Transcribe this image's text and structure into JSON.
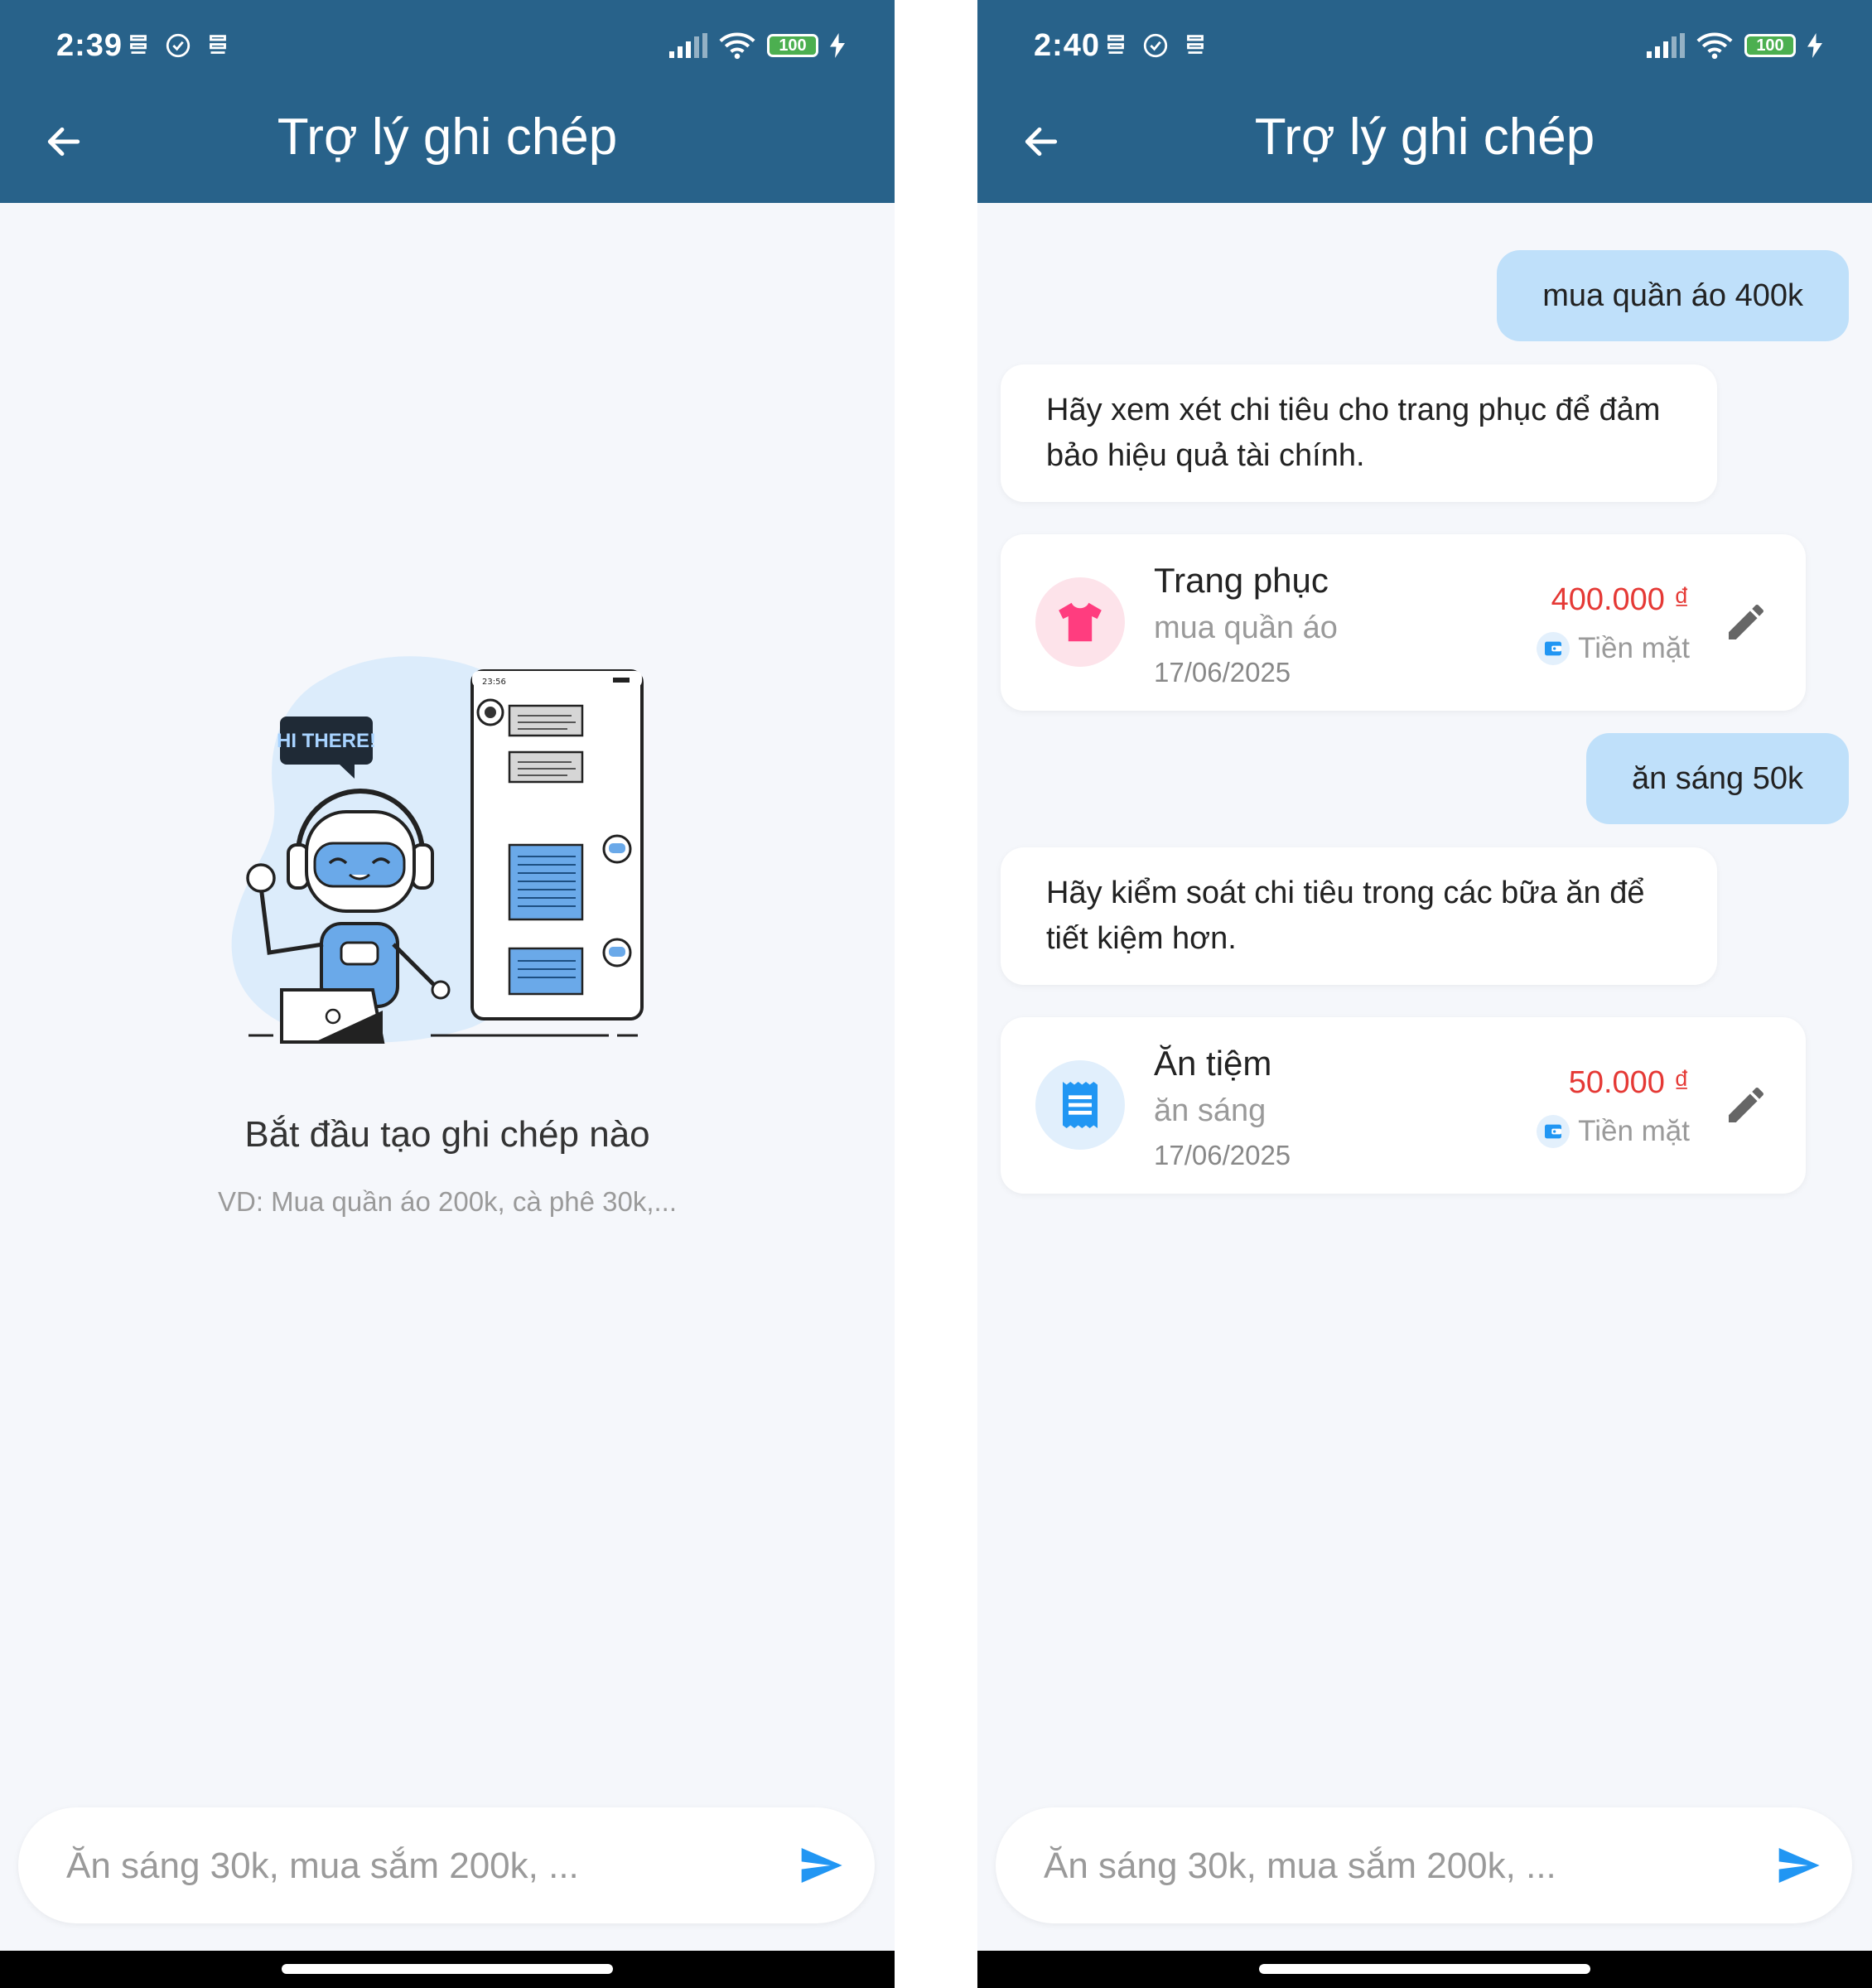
{
  "colors": {
    "header": "#28628a",
    "background": "#f5f7fb",
    "user_bubble": "#bfe0fa",
    "amount": "#e53935",
    "send": "#2196f3"
  },
  "left": {
    "status": {
      "time": "2:39",
      "battery": "100"
    },
    "app_bar": {
      "title": "Trợ lý ghi chép"
    },
    "illustration": {
      "bubble_text": "HI THERE!",
      "phone_clock": "23:56"
    },
    "empty_state": {
      "title": "Bắt đầu tạo ghi chép nào",
      "hint": "VD: Mua quần áo 200k, cà phê 30k,..."
    },
    "input": {
      "placeholder": "Ăn sáng 30k, mua sắm 200k, ..."
    }
  },
  "right": {
    "status": {
      "time": "2:40",
      "battery": "100"
    },
    "app_bar": {
      "title": "Trợ lý ghi chép"
    },
    "messages": [
      {
        "role": "user",
        "text": "mua quần áo 400k"
      },
      {
        "role": "bot",
        "text": "Hãy xem xét chi tiêu cho trang phục để đảm bảo hiệu quả tài chính."
      },
      {
        "role": "transaction",
        "icon": "tshirt-icon",
        "category": "Trang phục",
        "note": "mua quần áo",
        "date": "17/06/2025",
        "amount": "400.000 ₫",
        "wallet": "Tiền mặt"
      },
      {
        "role": "user",
        "text": "ăn sáng 50k"
      },
      {
        "role": "bot",
        "text": "Hãy kiểm soát chi tiêu trong các bữa ăn để tiết kiệm hơn."
      },
      {
        "role": "transaction",
        "icon": "receipt-icon",
        "category": "Ăn tiệm",
        "note": "ăn sáng",
        "date": "17/06/2025",
        "amount": "50.000 ₫",
        "wallet": "Tiền mặt"
      }
    ],
    "input": {
      "placeholder": "Ăn sáng 30k, mua sắm 200k, ..."
    }
  }
}
